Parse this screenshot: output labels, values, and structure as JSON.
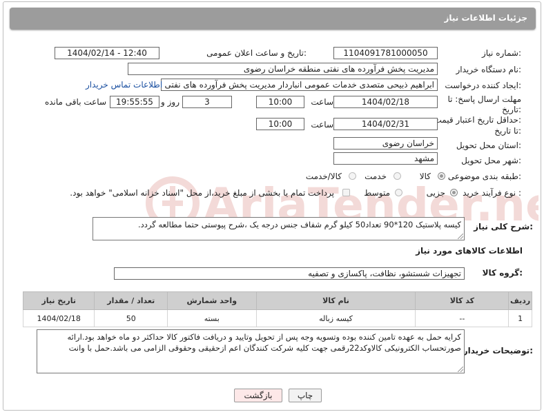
{
  "header": {
    "title": "جزئیات اطلاعات نیاز"
  },
  "form": {
    "need_number_label": "شماره نیاز:",
    "need_number": "1104091781000050",
    "announce_label": "تاریخ و ساعت اعلان عمومی:",
    "announce_value": "1404/02/14 - 12:40",
    "buyer_org_label": "نام دستگاه خریدار:",
    "buyer_org": "مدیریت پخش فرآورده های نفتی منطقه خراسان رضوی",
    "creator_label": "ایجاد کننده درخواست:",
    "creator": "ابراهیم ذبیحی متصدی خدمات عمومی انباردار مدیریت پخش فرآورده های نفتی منطقه خراسان رضوی",
    "contact_link": "اطلاعات تماس خریدار",
    "reply_deadline_label_1": "مهلت ارسال پاسخ: تا",
    "reply_deadline_label_2": "تاریخ:",
    "reply_date": "1404/02/18",
    "time_label": "ساعت",
    "reply_time": "10:00",
    "days_value": "3",
    "days_label": "روز و",
    "remaining_time": "19:55:55",
    "remaining_label": "ساعت باقی مانده",
    "price_deadline_label_1": "حداقل تاریخ اعتبار قیمت:",
    "price_deadline_label_2": "تا تاریخ:",
    "price_date": "1404/02/31",
    "price_time": "10:00",
    "province_label": "استان محل تحویل:",
    "province": "خراسان رضوی",
    "city_label": "شهر محل تحویل:",
    "city": "مشهد",
    "category_label": "طبقه بندی موضوعی:",
    "category_options": [
      "کالا",
      "خدمت",
      "کالا/خدمت"
    ],
    "category_selected": "کالا",
    "process_label": "نوع فرآیند خرید :",
    "process_options": [
      "جزیی",
      "متوسط"
    ],
    "process_selected": "جزیی",
    "payment_note": "پرداخت تمام یا بخشی از مبلغ خرید،از محل \"اسناد خزانه اسلامی\" خواهد بود.",
    "description_label": "شرح کلی نیاز:",
    "description": "کیسه پلاستیک 120*90  تعداد50 کیلو گرم شفاف جنس درجه یک ،شرح پیوستی حتما مطالعه گردد."
  },
  "goods": {
    "section_title": "اطلاعات کالاهای مورد نیاز",
    "group_label": "گروه کالا:",
    "group_value": "تجهیزات شستشو، نظافت، پاکسازی و تصفیه",
    "columns": [
      "ردیف",
      "کد کالا",
      "نام کالا",
      "واحد شمارش",
      "تعداد / مقدار",
      "تاریخ نیاز"
    ],
    "rows": [
      [
        "1",
        "--",
        "کیسه زباله",
        "بسته",
        "50",
        "1404/02/18"
      ]
    ]
  },
  "buyer_notes": {
    "label": "توضیحات خریدار:",
    "text": "کرایه حمل به عهده تامین کننده بوده وتسویه وجه پس از تحویل وتایید و دریافت فاکتور کالا حداکثر دو ماه خواهد بود.ارائه صورتحساب الکترونیکی کالاوکد22رقمی جهت کلیه شرکت کنندگان اعم ازحقیقی وحقوقی الزامی می باشد.حمل با وانت"
  },
  "buttons": {
    "print": "چاپ",
    "back": "بازگشت"
  },
  "watermark": {
    "text": "AriaTender.neT"
  },
  "colors": {
    "title_bar": "#9c9c9c",
    "link": "#1a4fa0",
    "back_button": "#fde8e8",
    "watermark": "#c0392b"
  }
}
